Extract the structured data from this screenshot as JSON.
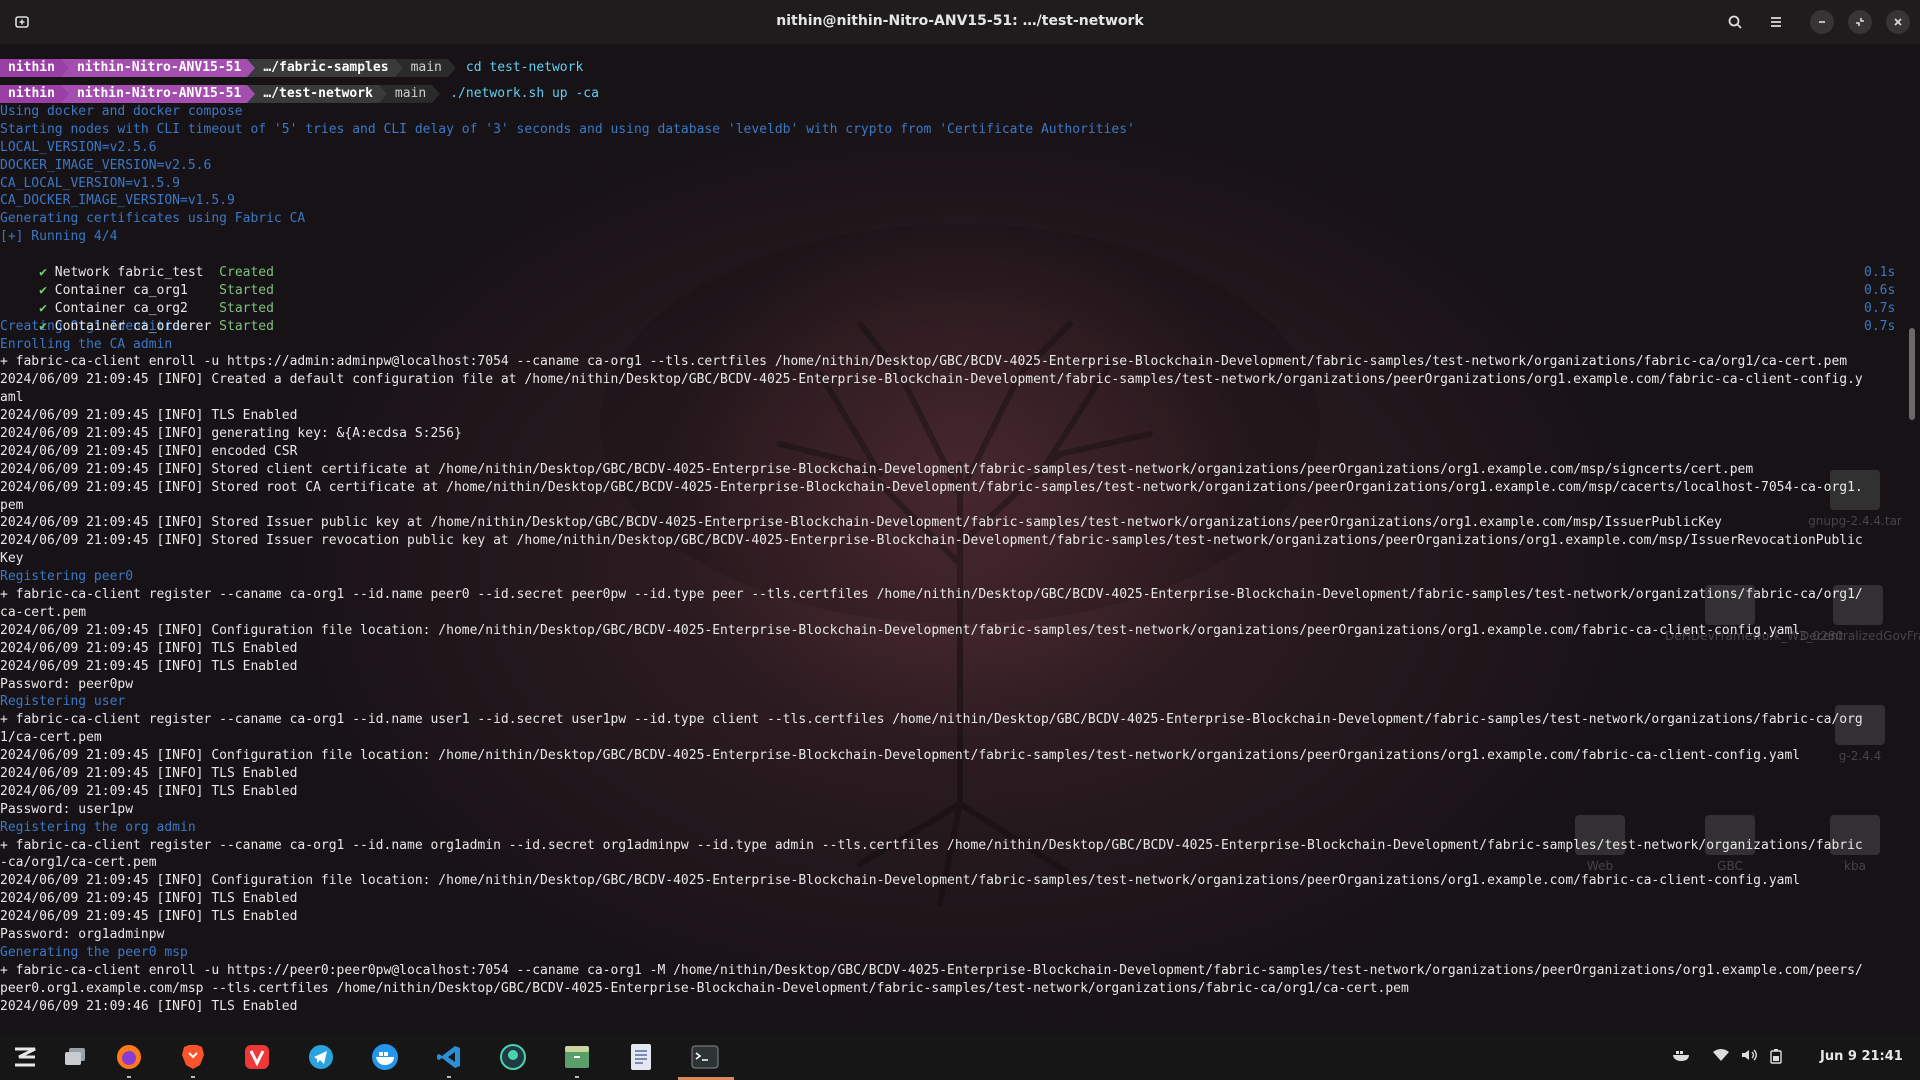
{
  "window": {
    "title": "nithin@nithin-Nitro-ANV15-51: …/test-network"
  },
  "prompts": [
    {
      "user": "nithin",
      "host": "nithin-Nitro-ANV15-51",
      "dir": "…/fabric-samples",
      "branch": "main",
      "command": "cd test-network"
    },
    {
      "user": "nithin",
      "host": "nithin-Nitro-ANV15-51",
      "dir": "…/test-network",
      "branch": "main",
      "command": "./network.sh up -ca"
    }
  ],
  "output": {
    "intro": [
      "Using docker and docker compose",
      "Starting nodes with CLI timeout of '5' tries and CLI delay of '3' seconds and using database 'leveldb' with crypto from 'Certificate Authorities'",
      "LOCAL_VERSION=v2.5.6",
      "DOCKER_IMAGE_VERSION=v2.5.6",
      "CA_LOCAL_VERSION=v1.5.9",
      "CA_DOCKER_IMAGE_VERSION=v1.5.9",
      "Generating certificates using Fabric CA",
      "[+] Running 4/4"
    ],
    "containers": [
      {
        "name": "Network fabric_test  ",
        "status": "Created",
        "time": "0.1s"
      },
      {
        "name": "Container ca_org1    ",
        "status": "Started",
        "time": "0.6s"
      },
      {
        "name": "Container ca_org2    ",
        "status": "Started",
        "time": "0.7s"
      },
      {
        "name": "Container ca_orderer ",
        "status": "Started",
        "time": "0.7s"
      }
    ],
    "log": [
      {
        "t": "info",
        "s": "Creating Org1 Identities"
      },
      {
        "t": "info",
        "s": "Enrolling the CA admin"
      },
      {
        "t": "ok",
        "s": "+ fabric-ca-client enroll -u https://admin:adminpw@localhost:7054 --caname ca-org1 --tls.certfiles /home/nithin/Desktop/GBC/BCDV-4025-Enterprise-Blockchain-Development/fabric-samples/test-network/organizations/fabric-ca/org1/ca-cert.pem"
      },
      {
        "t": "ok",
        "s": "2024/06/09 21:09:45 [INFO] Created a default configuration file at /home/nithin/Desktop/GBC/BCDV-4025-Enterprise-Blockchain-Development/fabric-samples/test-network/organizations/peerOrganizations/org1.example.com/fabric-ca-client-config.y"
      },
      {
        "t": "ok",
        "s": "aml"
      },
      {
        "t": "ok",
        "s": "2024/06/09 21:09:45 [INFO] TLS Enabled"
      },
      {
        "t": "ok",
        "s": "2024/06/09 21:09:45 [INFO] generating key: &{A:ecdsa S:256}"
      },
      {
        "t": "ok",
        "s": "2024/06/09 21:09:45 [INFO] encoded CSR"
      },
      {
        "t": "ok",
        "s": "2024/06/09 21:09:45 [INFO] Stored client certificate at /home/nithin/Desktop/GBC/BCDV-4025-Enterprise-Blockchain-Development/fabric-samples/test-network/organizations/peerOrganizations/org1.example.com/msp/signcerts/cert.pem"
      },
      {
        "t": "ok",
        "s": "2024/06/09 21:09:45 [INFO] Stored root CA certificate at /home/nithin/Desktop/GBC/BCDV-4025-Enterprise-Blockchain-Development/fabric-samples/test-network/organizations/peerOrganizations/org1.example.com/msp/cacerts/localhost-7054-ca-org1."
      },
      {
        "t": "ok",
        "s": "pem"
      },
      {
        "t": "ok",
        "s": "2024/06/09 21:09:45 [INFO] Stored Issuer public key at /home/nithin/Desktop/GBC/BCDV-4025-Enterprise-Blockchain-Development/fabric-samples/test-network/organizations/peerOrganizations/org1.example.com/msp/IssuerPublicKey"
      },
      {
        "t": "ok",
        "s": "2024/06/09 21:09:45 [INFO] Stored Issuer revocation public key at /home/nithin/Desktop/GBC/BCDV-4025-Enterprise-Blockchain-Development/fabric-samples/test-network/organizations/peerOrganizations/org1.example.com/msp/IssuerRevocationPublic"
      },
      {
        "t": "ok",
        "s": "Key"
      },
      {
        "t": "info",
        "s": "Registering peer0"
      },
      {
        "t": "ok",
        "s": "+ fabric-ca-client register --caname ca-org1 --id.name peer0 --id.secret peer0pw --id.type peer --tls.certfiles /home/nithin/Desktop/GBC/BCDV-4025-Enterprise-Blockchain-Development/fabric-samples/test-network/organizations/fabric-ca/org1/"
      },
      {
        "t": "ok",
        "s": "ca-cert.pem"
      },
      {
        "t": "ok",
        "s": "2024/06/09 21:09:45 [INFO] Configuration file location: /home/nithin/Desktop/GBC/BCDV-4025-Enterprise-Blockchain-Development/fabric-samples/test-network/organizations/peerOrganizations/org1.example.com/fabric-ca-client-config.yaml"
      },
      {
        "t": "ok",
        "s": "2024/06/09 21:09:45 [INFO] TLS Enabled"
      },
      {
        "t": "ok",
        "s": "2024/06/09 21:09:45 [INFO] TLS Enabled"
      },
      {
        "t": "ok",
        "s": "Password: peer0pw"
      },
      {
        "t": "info",
        "s": "Registering user"
      },
      {
        "t": "ok",
        "s": "+ fabric-ca-client register --caname ca-org1 --id.name user1 --id.secret user1pw --id.type client --tls.certfiles /home/nithin/Desktop/GBC/BCDV-4025-Enterprise-Blockchain-Development/fabric-samples/test-network/organizations/fabric-ca/org"
      },
      {
        "t": "ok",
        "s": "1/ca-cert.pem"
      },
      {
        "t": "ok",
        "s": "2024/06/09 21:09:45 [INFO] Configuration file location: /home/nithin/Desktop/GBC/BCDV-4025-Enterprise-Blockchain-Development/fabric-samples/test-network/organizations/peerOrganizations/org1.example.com/fabric-ca-client-config.yaml"
      },
      {
        "t": "ok",
        "s": "2024/06/09 21:09:45 [INFO] TLS Enabled"
      },
      {
        "t": "ok",
        "s": "2024/06/09 21:09:45 [INFO] TLS Enabled"
      },
      {
        "t": "ok",
        "s": "Password: user1pw"
      },
      {
        "t": "info",
        "s": "Registering the org admin"
      },
      {
        "t": "ok",
        "s": "+ fabric-ca-client register --caname ca-org1 --id.name org1admin --id.secret org1adminpw --id.type admin --tls.certfiles /home/nithin/Desktop/GBC/BCDV-4025-Enterprise-Blockchain-Development/fabric-samples/test-network/organizations/fabric"
      },
      {
        "t": "ok",
        "s": "-ca/org1/ca-cert.pem"
      },
      {
        "t": "ok",
        "s": "2024/06/09 21:09:45 [INFO] Configuration file location: /home/nithin/Desktop/GBC/BCDV-4025-Enterprise-Blockchain-Development/fabric-samples/test-network/organizations/peerOrganizations/org1.example.com/fabric-ca-client-config.yaml"
      },
      {
        "t": "ok",
        "s": "2024/06/09 21:09:45 [INFO] TLS Enabled"
      },
      {
        "t": "ok",
        "s": "2024/06/09 21:09:45 [INFO] TLS Enabled"
      },
      {
        "t": "ok",
        "s": "Password: org1adminpw"
      },
      {
        "t": "info",
        "s": "Generating the peer0 msp"
      },
      {
        "t": "ok",
        "s": "+ fabric-ca-client enroll -u https://peer0:peer0pw@localhost:7054 --caname ca-org1 -M /home/nithin/Desktop/GBC/BCDV-4025-Enterprise-Blockchain-Development/fabric-samples/test-network/organizations/peerOrganizations/org1.example.com/peers/"
      },
      {
        "t": "ok",
        "s": "peer0.org1.example.com/msp --tls.certfiles /home/nithin/Desktop/GBC/BCDV-4025-Enterprise-Blockchain-Development/fabric-samples/test-network/organizations/fabric-ca/org1/ca-cert.pem"
      },
      {
        "t": "ok",
        "s": "2024/06/09 21:09:46 [INFO] TLS Enabled"
      }
    ]
  },
  "desktop_icons": [
    {
      "label": "gnupg-2.4.4.tar"
    },
    {
      "label": "DeFiDevFramework_W3_0280"
    },
    {
      "label": "DecentralizedGovFramework_W"
    },
    {
      "label": "g-2.4.4"
    },
    {
      "label": "Web"
    },
    {
      "label": "GBC"
    },
    {
      "label": "kba"
    }
  ],
  "taskbar": {
    "apps": [
      "zorin-menu-icon",
      "files-icon",
      "firefox-icon",
      "brave-icon",
      "vivaldi-icon",
      "telegram-icon",
      "docker-icon",
      "vscode-icon",
      "app-icon",
      "file-manager-icon",
      "text-editor-icon",
      "terminal-icon"
    ],
    "clock": "Jun 9  21:41"
  },
  "colors": {
    "info": "#3b78c4",
    "prompt_user": "#9a3fa5",
    "command": "#5fd0f0",
    "active_app": "#d88a5a"
  }
}
